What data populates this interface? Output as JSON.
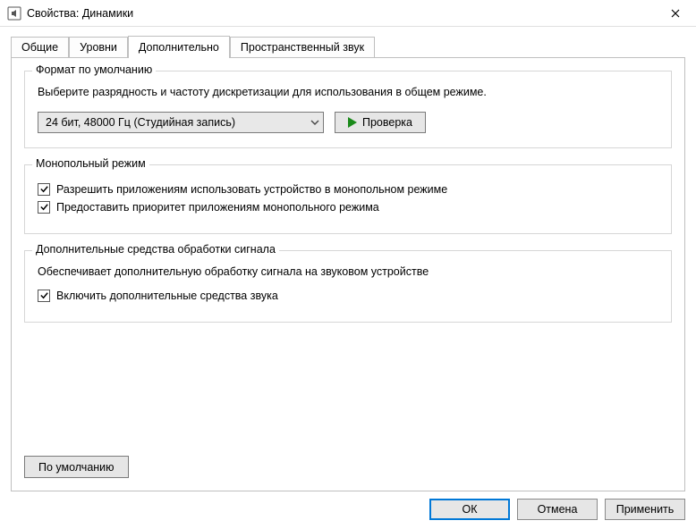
{
  "window": {
    "title": "Свойства: Динамики"
  },
  "tabs": {
    "general": "Общие",
    "levels": "Уровни",
    "advanced": "Дополнительно",
    "spatial": "Пространственный звук"
  },
  "group_default_format": {
    "legend": "Формат по умолчанию",
    "desc": "Выберите разрядность и частоту дискретизации для использования в общем режиме.",
    "selected": "24 бит, 48000 Гц (Студийная запись)",
    "test_btn": "Проверка"
  },
  "group_exclusive": {
    "legend": "Монопольный режим",
    "chk_allow": "Разрешить приложениям использовать устройство в монопольном режиме",
    "chk_priority": "Предоставить приоритет приложениям монопольного режима"
  },
  "group_enhancements": {
    "legend": "Дополнительные средства обработки сигнала",
    "desc": "Обеспечивает дополнительную обработку сигнала на звуковом устройстве",
    "chk_enable": "Включить дополнительные средства звука"
  },
  "restore_defaults": "По умолчанию",
  "footer": {
    "ok": "ОК",
    "cancel": "Отмена",
    "apply": "Применить"
  }
}
